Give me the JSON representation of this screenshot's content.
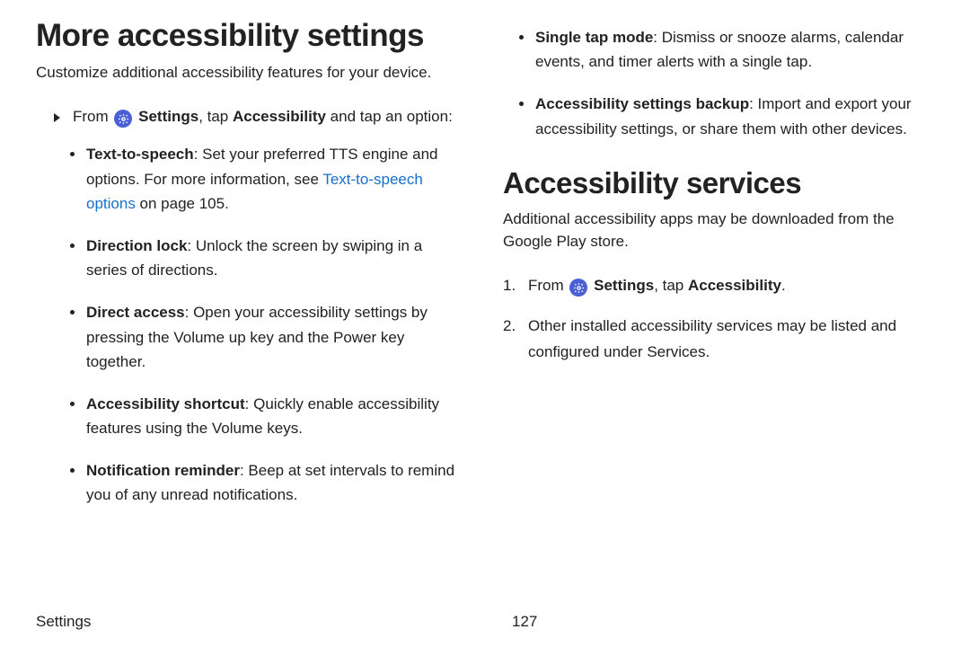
{
  "left": {
    "heading": "More accessibility settings",
    "subtitle": "Customize additional accessibility features for your device.",
    "from_prefix": "From ",
    "settings_label": "Settings",
    "from_suffix": ", tap ",
    "accessibility_label": "Accessibility",
    "from_end": " and tap an option:",
    "items": [
      {
        "title": "Text-to-speech",
        "body1": ": Set your preferred TTS engine and options. For more information, see ",
        "link": "Text-to-speech options",
        "body2": " on page 105."
      },
      {
        "title": "Direction lock",
        "body": ": Unlock the screen by swiping in a series of directions."
      },
      {
        "title": "Direct access",
        "body": ": Open your accessibility settings by pressing the Volume up key and the Power key together."
      },
      {
        "title": "Accessibility shortcut",
        "body": ": Quickly enable accessibility features using the Volume keys."
      },
      {
        "title": "Notification reminder",
        "body": ": Beep at set intervals to remind you of any unread notifications."
      }
    ]
  },
  "right": {
    "top_items": [
      {
        "title": "Single tap mode",
        "body": ": Dismiss or snooze alarms, calendar events, and timer alerts with a single tap."
      },
      {
        "title": "Accessibility settings backup",
        "body": ": Import and export your accessibility settings, or share them with other devices."
      }
    ],
    "heading": "Accessibility services",
    "subtitle": "Additional accessibility apps may be downloaded from the Google Play store.",
    "step1_prefix": "From ",
    "step1_settings": "Settings",
    "step1_mid": ", tap ",
    "step1_access": "Accessibility",
    "step1_end": ".",
    "step2": "Other installed accessibility services may be listed and configured under Services."
  },
  "footer": {
    "section": "Settings",
    "page": "127"
  }
}
